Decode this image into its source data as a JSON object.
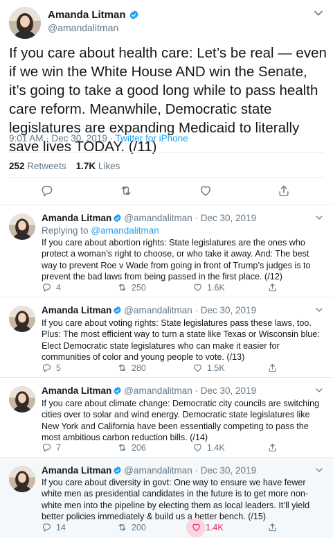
{
  "main_tweet": {
    "name": "Amanda Litman",
    "handle": "@amandalitman",
    "text": "If you care about health care: Let’s be real — even if we win the White House AND win the Senate, it’s going to take a good long while to pass health care reform. Meanwhile, Democratic state legislatures are expanding Medicaid to literally save lives TODAY. (/11)",
    "time": "9:01 AM · Dec 30, 2019 · ",
    "source": "Twitter for iPhone",
    "retweets_count": "252",
    "retweets_label": "Retweets",
    "likes_count": "1.7K",
    "likes_label": "Likes"
  },
  "replies": [
    {
      "name": "Amanda Litman",
      "handle": "@amandalitman · Dec 30, 2019",
      "replying_prefix": "Replying to ",
      "replying_to": "@amandalitman",
      "text": "If you care about abortion rights: State legislatures are the ones who protect a woman’s right to choose, or who take it away. And: The best way to prevent Roe v Wade from going in front of Trump’s judges is to prevent the bad laws from being passed in the first place. (/12)",
      "replies": "4",
      "retweets": "250",
      "likes": "1.6K"
    },
    {
      "name": "Amanda Litman",
      "handle": "@amandalitman · Dec 30, 2019",
      "text": "If you care about voting rights: State legislatures pass these laws, too. Plus: The most efficient way to turn a state like Texas or Wisconsin blue: Elect Democratic state legislatures who can make it easier for communities of color and young people to vote. (/13)",
      "replies": "5",
      "retweets": "280",
      "likes": "1.5K"
    },
    {
      "name": "Amanda Litman",
      "handle": "@amandalitman · Dec 30, 2019",
      "text": "If you care about climate change: Democratic city councils are switching cities over to solar and wind energy. Democratic state legislatures like New York and California have been essentially competing to pass the most ambitious carbon reduction bills. (/14)",
      "replies": "7",
      "retweets": "206",
      "likes": "1.4K"
    },
    {
      "name": "Amanda Litman",
      "handle": "@amandalitman · Dec 30, 2019",
      "text": "If you care about diversity in govt: One way to ensure we have fewer white men as presidential candidates in the future is to get more non-white men into the pipeline by electing them as local leaders. It’ll yield better policies immediately & build us a better bench. (/15)",
      "replies": "14",
      "retweets": "200",
      "likes": "1.4K"
    }
  ],
  "icons": {
    "reply": "reply-icon",
    "retweet": "retweet-icon",
    "like": "heart-icon",
    "share": "share-icon",
    "verified": "verified-badge-icon",
    "menu": "chevron-down-icon"
  },
  "colors": {
    "accent": "#1da1f2",
    "secondary_text": "#657786",
    "like_active": "#e0245e",
    "highlight_bg": "#f5f8fa"
  }
}
